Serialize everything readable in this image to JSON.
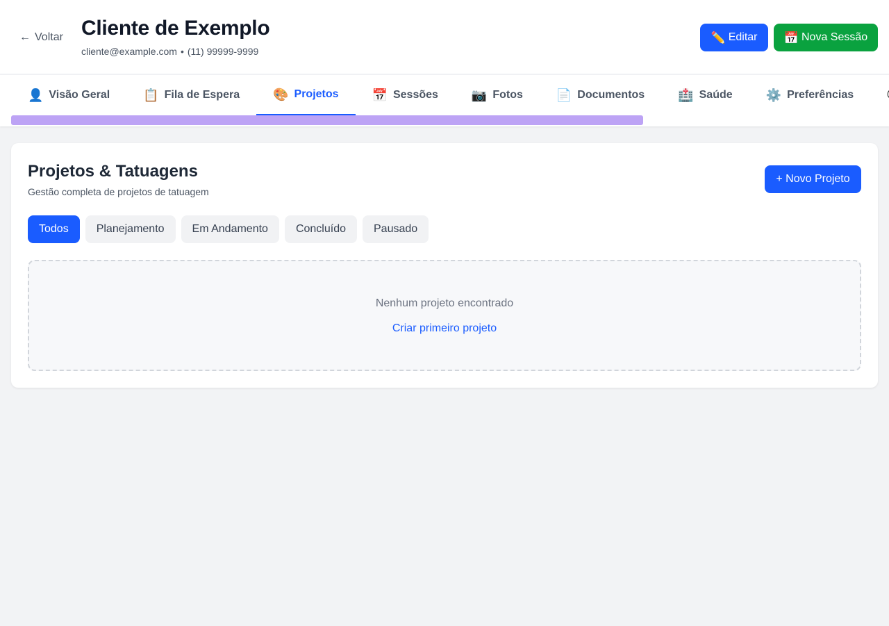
{
  "header": {
    "back_label": "Voltar",
    "client_name": "Cliente de Exemplo",
    "email": "cliente@example.com",
    "separator": "•",
    "phone": "(11) 99999-9999",
    "edit_icon": "✏️",
    "edit_label": "Editar",
    "session_icon": "📅",
    "session_label": "Nova Sessão"
  },
  "tabs": [
    {
      "icon": "👤",
      "label": "Visão Geral"
    },
    {
      "icon": "📋",
      "label": "Fila de Espera"
    },
    {
      "icon": "🎨",
      "label": "Projetos"
    },
    {
      "icon": "📅",
      "label": "Sessões"
    },
    {
      "icon": "📷",
      "label": "Fotos"
    },
    {
      "icon": "📄",
      "label": "Documentos"
    },
    {
      "icon": "🏥",
      "label": "Saúde"
    },
    {
      "icon": "⚙️",
      "label": "Preferências"
    },
    {
      "icon": "💬",
      "label": ""
    }
  ],
  "active_tab": "Projetos",
  "projects": {
    "title": "Projetos & Tatuagens",
    "subtitle": "Gestão completa de projetos de tatuagem",
    "new_button": "+ Novo Projeto",
    "filters": [
      "Todos",
      "Planejamento",
      "Em Andamento",
      "Concluído",
      "Pausado"
    ],
    "active_filter": "Todos",
    "empty_message": "Nenhum projeto encontrado",
    "empty_action": "Criar primeiro projeto"
  },
  "colors": {
    "primary": "#1a5cff",
    "success": "#0aa23f",
    "scrollbar_thumb": "#bda3f5",
    "background": "#f2f3f5"
  }
}
